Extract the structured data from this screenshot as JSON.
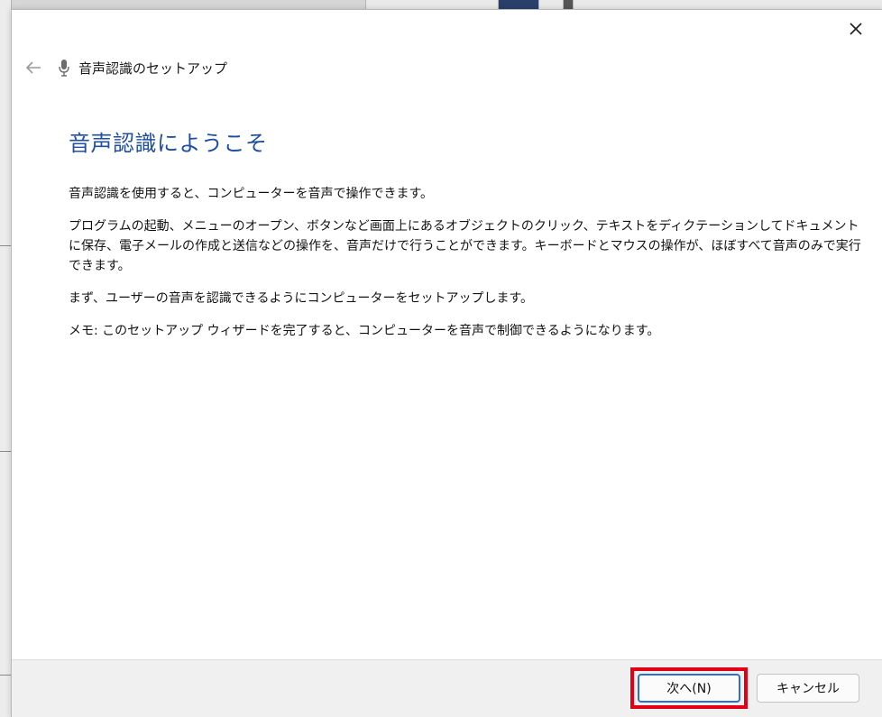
{
  "window": {
    "title": "音声認識のセットアップ",
    "close_glyph": "✕"
  },
  "icons": {
    "back": "arrow-left-icon",
    "app": "microphone-icon",
    "close": "close-icon"
  },
  "main": {
    "heading": "音声認識にようこそ",
    "paragraphs": [
      "音声認識を使用すると、コンピューターを音声で操作できます。",
      "プログラムの起動、メニューのオープン、ボタンなど画面上にあるオブジェクトのクリック、テキストをディクテーションしてドキュメントに保存、電子メールの作成と送信などの操作を、音声だけで行うことができます。キーボードとマウスの操作が、ほぼすべて音声のみで実行できます。",
      "まず、ユーザーの音声を認識できるようにコンピューターをセットアップします。",
      "メモ: このセットアップ ウィザードを完了すると、コンピューターを音声で制御できるようになります。"
    ]
  },
  "footer": {
    "next_label": "次へ(N)",
    "cancel_label": "キャンセル"
  },
  "colors": {
    "heading": "#1f4f9e",
    "highlight": "#e10014",
    "focus_border": "#2f6fd0"
  }
}
